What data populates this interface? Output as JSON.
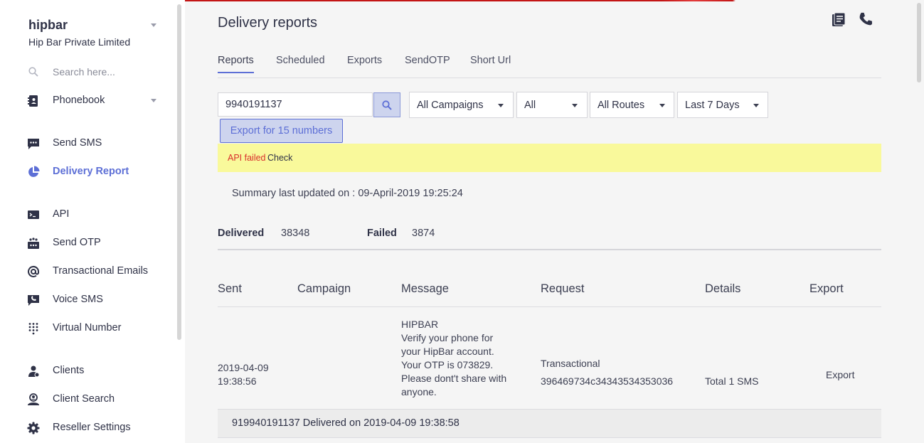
{
  "colors": {
    "accent": "#5d6fd6",
    "alert_bg": "#f9f99b",
    "error": "#d9302c"
  },
  "sidebar": {
    "brand": "hipbar",
    "company": "Hip Bar Private Limited",
    "search_placeholder": "Search here...",
    "items": [
      {
        "label": "Phonebook",
        "icon": "phonebook-icon"
      },
      {
        "label": "Send SMS",
        "icon": "sms-icon"
      },
      {
        "label": "Delivery Report",
        "icon": "pie-chart-icon"
      },
      {
        "label": "API",
        "icon": "terminal-icon"
      },
      {
        "label": "Send OTP",
        "icon": "otp-icon"
      },
      {
        "label": "Transactional Emails",
        "icon": "at-icon"
      },
      {
        "label": "Voice SMS",
        "icon": "voice-sms-icon"
      },
      {
        "label": "Virtual Number",
        "icon": "dialpad-icon"
      },
      {
        "label": "Clients",
        "icon": "clients-icon"
      },
      {
        "label": "Client Search",
        "icon": "client-search-icon"
      },
      {
        "label": "Reseller Settings",
        "icon": "gear-icon"
      }
    ]
  },
  "header": {
    "title": "Delivery reports"
  },
  "tabs": [
    "Reports",
    "Scheduled",
    "Exports",
    "SendOTP",
    "Short Url"
  ],
  "filters": {
    "search_value": "9940191137",
    "campaigns": "All Campaigns",
    "status": "All",
    "routes": "All Routes",
    "period": "Last 7 Days",
    "export_label": "Export for 15 numbers"
  },
  "alert": {
    "error": "API failed",
    "action": "Check"
  },
  "summary": "Summary last updated on : 09-April-2019 19:25:24",
  "stats": {
    "delivered_label": "Delivered",
    "delivered_value": "38348",
    "failed_label": "Failed",
    "failed_value": "3874"
  },
  "table": {
    "headers": [
      "Sent",
      "Campaign",
      "Message",
      "Request",
      "Details",
      "Export"
    ],
    "row": {
      "sent_date": "2019-04-09",
      "sent_time": "19:38:56",
      "campaign": "",
      "message_lines": [
        "HIPBAR",
        "Verify your phone for",
        "your HipBar account.",
        "Your OTP is 073829.",
        "Please dont't share with",
        "anyone."
      ],
      "request_type": "Transactional",
      "request_id": "396469734c34343534353036",
      "details": "Total 1 SMS",
      "export": "Export"
    },
    "delivery_detail": "919940191137 Delivered on 2019-04-09 19:38:58"
  }
}
